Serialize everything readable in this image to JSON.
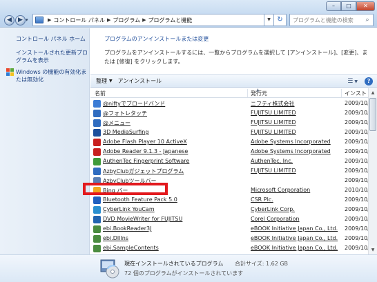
{
  "address": {
    "crumbs": [
      "コントロール パネル",
      "プログラム",
      "プログラムと機能"
    ],
    "search_placeholder": "プログラムと機能の検索"
  },
  "sidebar": {
    "links": [
      "コントロール パネル ホーム",
      "インストールされた更新プログラムを表示",
      "Windows の機能の有効化または無効化"
    ]
  },
  "main": {
    "title": "プログラムのアンインストールまたは変更",
    "description": "プログラムをアンインストールするには、一覧からプログラムを選択して [アンインストール]、[変更]、または [修復] をクリックします。"
  },
  "toolbar": {
    "organize": "整理",
    "uninstall": "アンインストール"
  },
  "columns": {
    "name": "名前",
    "publisher": "発行元",
    "installed": "インスト"
  },
  "programs": [
    {
      "name": "@niftyでブロードバンド",
      "publisher": "ニフティ株式会社",
      "date": "2009/10/",
      "icon_color": "#3a7bd5"
    },
    {
      "name": "@フォトレタッチ",
      "publisher": "FUJITSU LIMITED",
      "date": "2009/10/",
      "icon_color": "#2f6cc0"
    },
    {
      "name": "@メニュー",
      "publisher": "FUJITSU LIMITED",
      "date": "2009/10/",
      "icon_color": "#2f6cc0"
    },
    {
      "name": "3D MediaSurfing",
      "publisher": "FUJITSU LIMITED",
      "date": "2009/10/",
      "icon_color": "#1c4f9c"
    },
    {
      "name": "Adobe Flash Player 10 ActiveX",
      "publisher": "Adobe Systems Incorporated",
      "date": "2009/10/",
      "icon_color": "#c8201e"
    },
    {
      "name": "Adobe Reader 9.1.3 - Japanese",
      "publisher": "Adobe Systems Incorporated",
      "date": "2009/10/",
      "icon_color": "#c8201e"
    },
    {
      "name": "AuthenTec Fingerprint Software",
      "publisher": "AuthenTec, Inc.",
      "date": "2009/10/",
      "icon_color": "#3f9a3a"
    },
    {
      "name": "AzbyClubガジェットプログラム",
      "publisher": "FUJITSU LIMITED",
      "date": "2009/10/",
      "icon_color": "#2f6cc0"
    },
    {
      "name": "AzbyClubツールバー",
      "publisher": "",
      "date": "2009/10/",
      "icon_color": "#5a7fb5"
    },
    {
      "name": "Bing バー",
      "publisher": "Microsoft Corporation",
      "date": "2010/10/",
      "icon_color": "#f2a81c"
    },
    {
      "name": "Bluetooth Feature Pack 5.0",
      "publisher": "CSR Plc.",
      "date": "2009/10/",
      "icon_color": "#1f5fbf"
    },
    {
      "name": "CyberLink YouCam",
      "publisher": "CyberLink Corp.",
      "date": "2009/10/",
      "icon_color": "#2a8fd0"
    },
    {
      "name": "DVD MovieWriter for FUJITSU",
      "publisher": "Corel Corporation",
      "date": "2009/10/",
      "icon_color": "#2264b0"
    },
    {
      "name": "ebi.BookReader3J",
      "publisher": "eBOOK Initiative Japan Co., Ltd.",
      "date": "2009/10/",
      "icon_color": "#4a8c3f"
    },
    {
      "name": "ebi.DllIns",
      "publisher": "eBOOK Initiative Japan Co., Ltd.",
      "date": "2009/10/",
      "icon_color": "#4a8c3f"
    },
    {
      "name": "ebi.SampleContents",
      "publisher": "eBOOK Initiative Japan Co., Ltd.",
      "date": "2009/10/",
      "icon_color": "#4a8c3f"
    }
  ],
  "footer": {
    "line1": "現在インストールされているプログラム",
    "size": "合計サイズ: 1.62 GB",
    "line2": "72 個のプログラムがインストールされています"
  }
}
